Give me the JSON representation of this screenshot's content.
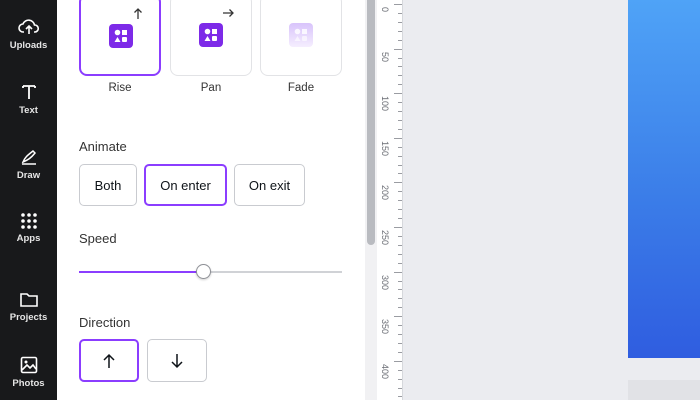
{
  "rail": {
    "items": [
      {
        "label": "Uploads",
        "icon": "upload-cloud-icon"
      },
      {
        "label": "Text",
        "icon": "text-t-icon"
      },
      {
        "label": "Draw",
        "icon": "pen-icon"
      },
      {
        "label": "Apps",
        "icon": "grid-icon"
      },
      {
        "label": "Projects",
        "icon": "folder-icon"
      },
      {
        "label": "Photos",
        "icon": "image-icon"
      }
    ]
  },
  "animations": {
    "selected": "Rise",
    "items": [
      {
        "label": "Rise",
        "icon": "arrow-up-icon"
      },
      {
        "label": "Pan",
        "icon": "arrow-right-icon"
      },
      {
        "label": "Fade",
        "icon": "fade-icon"
      }
    ]
  },
  "animate": {
    "title": "Animate",
    "selected": "On enter",
    "options": [
      "Both",
      "On enter",
      "On exit"
    ]
  },
  "speed": {
    "title": "Speed",
    "value": 0.47
  },
  "direction": {
    "title": "Direction",
    "selected": "up",
    "options": [
      "up",
      "down"
    ]
  },
  "ruler": {
    "labels": [
      "0",
      "50",
      "100",
      "150",
      "200",
      "250",
      "300",
      "350",
      "400"
    ]
  },
  "colors": {
    "accent": "#8b3dff",
    "rail_bg": "#18191b",
    "page_gradient_top": "#4fa3f7",
    "page_gradient_bottom": "#2f5de0"
  }
}
